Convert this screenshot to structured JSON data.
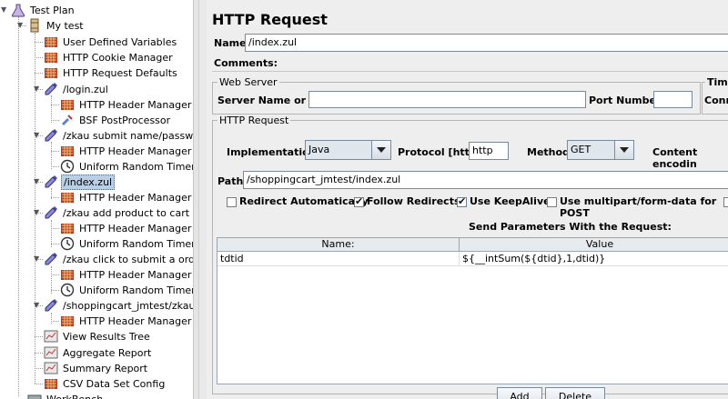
{
  "tree": {
    "items": [
      {
        "label": "Test Plan",
        "icon": "flask-icon"
      },
      {
        "label": "My test",
        "icon": "spool-icon"
      },
      {
        "label": "User Defined Variables",
        "icon": "config-icon"
      },
      {
        "label": "HTTP Cookie Manager",
        "icon": "config-icon"
      },
      {
        "label": "HTTP Request Defaults",
        "icon": "config-icon"
      },
      {
        "label": "/login.zul",
        "icon": "pipette-icon"
      },
      {
        "label": "HTTP Header Manager",
        "icon": "config-icon"
      },
      {
        "label": "BSF PostProcessor",
        "icon": "processor-icon"
      },
      {
        "label": "/zkau  submit  name/password",
        "icon": "pipette-icon"
      },
      {
        "label": "HTTP Header Manager",
        "icon": "config-icon"
      },
      {
        "label": "Uniform Random Timer",
        "icon": "clock-icon"
      },
      {
        "label": "/index.zul",
        "icon": "pipette-icon"
      },
      {
        "label": "HTTP Header Manager",
        "icon": "config-icon"
      },
      {
        "label": "/zkau  add  product  to cart",
        "icon": "pipette-icon"
      },
      {
        "label": "HTTP Header Manager",
        "icon": "config-icon"
      },
      {
        "label": "Uniform Random Timer",
        "icon": "clock-icon"
      },
      {
        "label": "/zkau  click to submit a order",
        "icon": "pipette-icon"
      },
      {
        "label": "HTTP Header Manager",
        "icon": "config-icon"
      },
      {
        "label": "Uniform Random Timer",
        "icon": "clock-icon"
      },
      {
        "label": "/shoppingcart_jmtest/zkau",
        "icon": "pipette-icon"
      },
      {
        "label": "HTTP Header Manager",
        "icon": "config-icon"
      },
      {
        "label": "View Results Tree",
        "icon": "listener-icon"
      },
      {
        "label": "Aggregate Report",
        "icon": "listener-icon"
      },
      {
        "label": "Summary Report",
        "icon": "listener-icon"
      },
      {
        "label": "CSV Data Set Config",
        "icon": "config-icon"
      },
      {
        "label": "WorkBench",
        "icon": "workbench-icon"
      }
    ]
  },
  "panel": {
    "title": "HTTP Request",
    "name_label": "Name:",
    "name_value": "/index.zul",
    "comments_label": "Comments:",
    "web_server": {
      "legend": "Web Server",
      "server_label": "Server Name or IP:",
      "server_value": "",
      "port_label": "Port Number:",
      "port_value": ""
    },
    "timeouts": {
      "legend": "Time",
      "connect_label": "Conn"
    },
    "http_request": {
      "legend": "HTTP Request",
      "impl_label": "Implementation:",
      "impl_value": "Java",
      "protocol_label": "Protocol [http]:",
      "protocol_value": "http",
      "method_label": "Method:",
      "method_value": "GET",
      "encoding_label": "Content encodin",
      "path_label": "Path:",
      "path_value": "/shoppingcart_jmtest/index.zul"
    },
    "options": [
      {
        "label": "Redirect Automatically",
        "checked": false
      },
      {
        "label": "Follow Redirects",
        "checked": true
      },
      {
        "label": "Use KeepAlive",
        "checked": true
      },
      {
        "label": "Use multipart/form-data for POST",
        "checked": false
      }
    ],
    "params": {
      "title": "Send Parameters With the Request:",
      "columns": [
        "Name:",
        "Value"
      ],
      "rows": [
        {
          "name": "tdtid",
          "value": "${__intSum(${dtid},1,dtid)}"
        }
      ]
    },
    "buttons": {
      "add": "Add",
      "delete": "Delete"
    }
  }
}
